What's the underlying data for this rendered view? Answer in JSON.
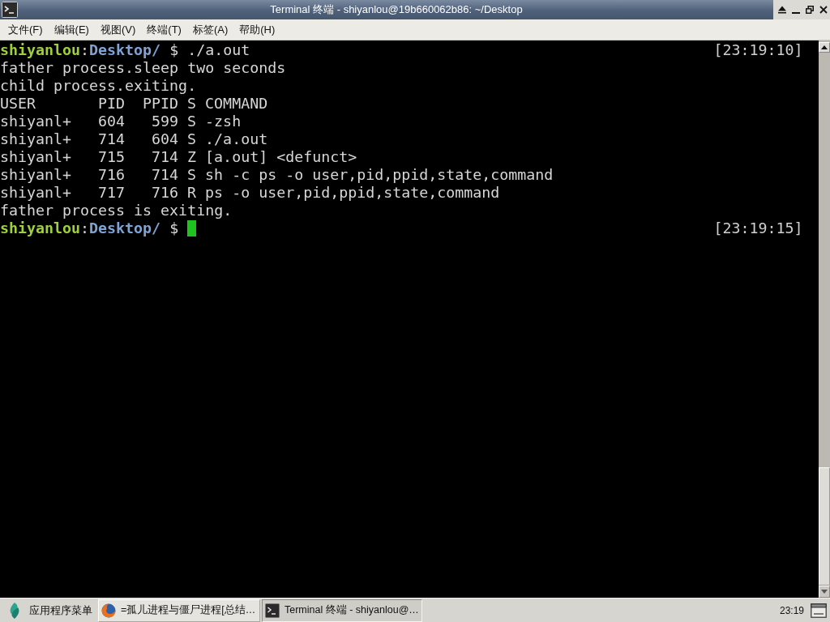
{
  "window": {
    "title": "Terminal 终端 - shiyanlou@19b660062b86: ~/Desktop"
  },
  "menu": [
    {
      "label": "文件(F)"
    },
    {
      "label": "编辑(E)"
    },
    {
      "label": "视图(V)"
    },
    {
      "label": "终端(T)"
    },
    {
      "label": "标签(A)"
    },
    {
      "label": "帮助(H)"
    }
  ],
  "terminal": {
    "lines": [
      {
        "kind": "prompt",
        "user": "shiyanlou",
        "separator": ":",
        "directory": "Desktop/",
        "symbol": "$",
        "command": "./a.out",
        "time": "[23:19:10]",
        "cursor": false
      },
      {
        "kind": "output",
        "text": "father process.sleep two seconds"
      },
      {
        "kind": "output",
        "text": "child process.exiting."
      },
      {
        "kind": "table",
        "columns": [
          "USER",
          "PID",
          "PPID",
          "S",
          "COMMAND"
        ],
        "rows": [
          [
            "shiyanl+",
            "604",
            "599",
            "S",
            "-zsh"
          ],
          [
            "shiyanl+",
            "714",
            "604",
            "S",
            "./a.out"
          ],
          [
            "shiyanl+",
            "715",
            "714",
            "Z",
            "[a.out] <defunct>"
          ],
          [
            "shiyanl+",
            "716",
            "714",
            "S",
            "sh -c ps -o user,pid,ppid,state,command"
          ],
          [
            "shiyanl+",
            "717",
            "716",
            "R",
            "ps -o user,pid,ppid,state,command"
          ]
        ]
      },
      {
        "kind": "output",
        "text": "father process is exiting."
      },
      {
        "kind": "prompt",
        "user": "shiyanlou",
        "separator": ":",
        "directory": "Desktop/",
        "symbol": "$",
        "time": "[23:19:15]",
        "cursor": true
      }
    ]
  },
  "taskbar": {
    "menu_label": "应用程序菜单",
    "tasks": [
      {
        "kind": "browser",
        "label": "=孤儿进程与僵尸进程[总结…",
        "selected": false
      },
      {
        "kind": "terminal",
        "label": "Terminal 终端 - shiyanlou@…",
        "selected": true
      }
    ],
    "clock": "23:19"
  }
}
